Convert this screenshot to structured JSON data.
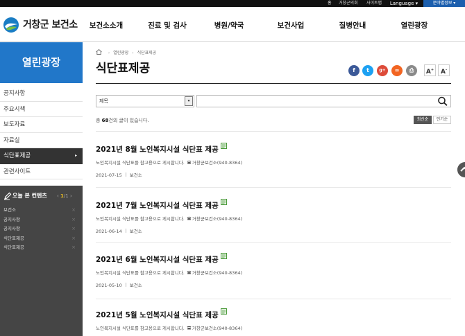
{
  "topbar": {
    "home": "홈",
    "council": "거창군의회",
    "sitemap": "사이트맵",
    "language": "Language ▾",
    "branch": "분야별정보 ▾"
  },
  "header": {
    "logo_text": "거창군 보건소",
    "nav": [
      "보건소소개",
      "진료 및 검사",
      "병원/약국",
      "보건사업",
      "질병안내",
      "열린광장"
    ]
  },
  "sidebar": {
    "title": "열린광장",
    "items": [
      {
        "label": "공지사항"
      },
      {
        "label": "주요시책"
      },
      {
        "label": "보도자료"
      },
      {
        "label": "자료실"
      },
      {
        "label": "식단표제공"
      },
      {
        "label": "관련사이트"
      }
    ],
    "active_arrow": "▸"
  },
  "recent_viewed": {
    "title": "오늘 본 컨텐츠",
    "pager_prev": "‹",
    "pager_current": "1",
    "pager_total": "/1",
    "pager_next": "›",
    "items": [
      "보건소",
      "공지사항",
      "공지사항",
      "식단표제공",
      "식단표제공"
    ],
    "close": "×"
  },
  "breadcrumb": {
    "items": [
      "열린광장",
      "식단표제공"
    ],
    "sep": "›"
  },
  "page": {
    "title": "식단표제공"
  },
  "share": {
    "facebook": "f",
    "twitter": "t",
    "google": "g+",
    "link": "∞",
    "print": "⎙"
  },
  "font_size": {
    "plus": "A",
    "plus_sup": "+",
    "minus": "A",
    "minus_sup": "-"
  },
  "search": {
    "field_selected": "제목",
    "caret": "▾",
    "value": ""
  },
  "list_info": {
    "prefix": "총 ",
    "count": "68",
    "suffix": "건의 글이 있습니다."
  },
  "sort": {
    "latest": "최신순",
    "popular": "인기순"
  },
  "posts": [
    {
      "title": "2021년 8월 노인복지시설 식단표 제공",
      "desc": "노인복지시설 식단표를 참고용으로 게시합니다.",
      "contact": "거창군보건소(940-8364)",
      "date": "2021-07-15",
      "author": "보건소"
    },
    {
      "title": "2021년 7월 노인복지시설 식단표 제공",
      "desc": "노인복지시설 식단표를 참고용으로 게시합니다.",
      "contact": "거창군보건소(940-8364)",
      "date": "2021-06-14",
      "author": "보건소"
    },
    {
      "title": "2021년 6월 노인복지시설 식단표 제공",
      "desc": "노인복지시설 식단표를 참고용으로 게시합니다.",
      "contact": "거창군보건소(940-8364)",
      "date": "2021-05-10",
      "author": "보건소"
    },
    {
      "title": "2021년 5월 노인복지시설 식단표 제공",
      "desc": "노인복지시설 식단표를 참고용으로 게시합니다.",
      "contact": "거창군보건소(940-8364)",
      "date": "",
      "author": ""
    }
  ],
  "colors": {
    "accent": "#2177c9",
    "sidebar_active": "#333333",
    "recent_bg": "#454545",
    "branch_bg": "#1c5fae"
  }
}
